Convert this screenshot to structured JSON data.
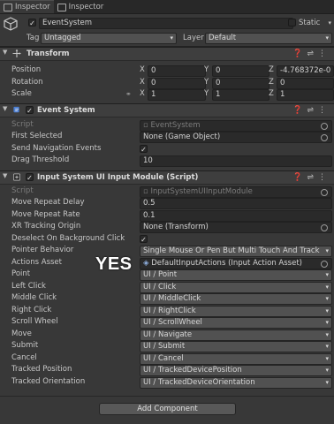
{
  "tabs": [
    {
      "label": "Inspector"
    },
    {
      "label": "Inspector"
    }
  ],
  "gameobject": {
    "active": true,
    "name": "EventSystem",
    "static_label": "Static",
    "static_checked": false,
    "tag_label": "Tag",
    "tag_value": "Untagged",
    "layer_label": "Layer",
    "layer_value": "Default"
  },
  "transform": {
    "title": "Transform",
    "position": {
      "label": "Position",
      "x": "0",
      "y": "0",
      "z": "-4.768372e-0"
    },
    "rotation": {
      "label": "Rotation",
      "x": "0",
      "y": "0",
      "z": "0"
    },
    "scale": {
      "label": "Scale",
      "x": "1",
      "y": "1",
      "z": "1"
    },
    "axis": {
      "x": "X",
      "y": "Y",
      "z": "Z"
    }
  },
  "event_system": {
    "title": "Event System",
    "enabled": true,
    "rows": [
      {
        "label": "Script",
        "value": "EventSystem"
      },
      {
        "label": "First Selected",
        "value": "None (Game Object)"
      },
      {
        "label": "Send Navigation Events",
        "value": "✓"
      },
      {
        "label": "Drag Threshold",
        "value": "10"
      }
    ]
  },
  "input_module": {
    "title": "Input System UI Input Module (Script)",
    "enabled": true,
    "script": {
      "label": "Script",
      "value": "InputSystemUIInputModule"
    },
    "move_repeat_delay": {
      "label": "Move Repeat Delay",
      "value": "0.5"
    },
    "move_repeat_rate": {
      "label": "Move Repeat Rate",
      "value": "0.1"
    },
    "xr_origin": {
      "label": "XR Tracking Origin",
      "value": "None (Transform)"
    },
    "deselect": {
      "label": "Deselect On Background Click",
      "value": "✓"
    },
    "pointer_behavior": {
      "label": "Pointer Behavior",
      "value": "Single Mouse Or Pen But Multi Touch And Track"
    },
    "actions_asset": {
      "label": "Actions Asset",
      "value": "DefaultInputActions (Input Action Asset)"
    },
    "actions": [
      {
        "label": "Point",
        "value": "UI / Point"
      },
      {
        "label": "Left Click",
        "value": "UI / Click"
      },
      {
        "label": "Middle Click",
        "value": "UI / MiddleClick"
      },
      {
        "label": "Right Click",
        "value": "UI / RightClick"
      },
      {
        "label": "Scroll Wheel",
        "value": "UI / ScrollWheel"
      },
      {
        "label": "Move",
        "value": "UI / Navigate"
      },
      {
        "label": "Submit",
        "value": "UI / Submit"
      },
      {
        "label": "Cancel",
        "value": "UI / Cancel"
      },
      {
        "label": "Tracked Position",
        "value": "UI / TrackedDevicePosition"
      },
      {
        "label": "Tracked Orientation",
        "value": "UI / TrackedDeviceOrientation"
      }
    ]
  },
  "add_component": "Add Component",
  "overlay_text": "YES",
  "colors": {
    "bg": "#383838",
    "field": "#2a2a2a",
    "accent_blue": "#4c7fd3"
  }
}
